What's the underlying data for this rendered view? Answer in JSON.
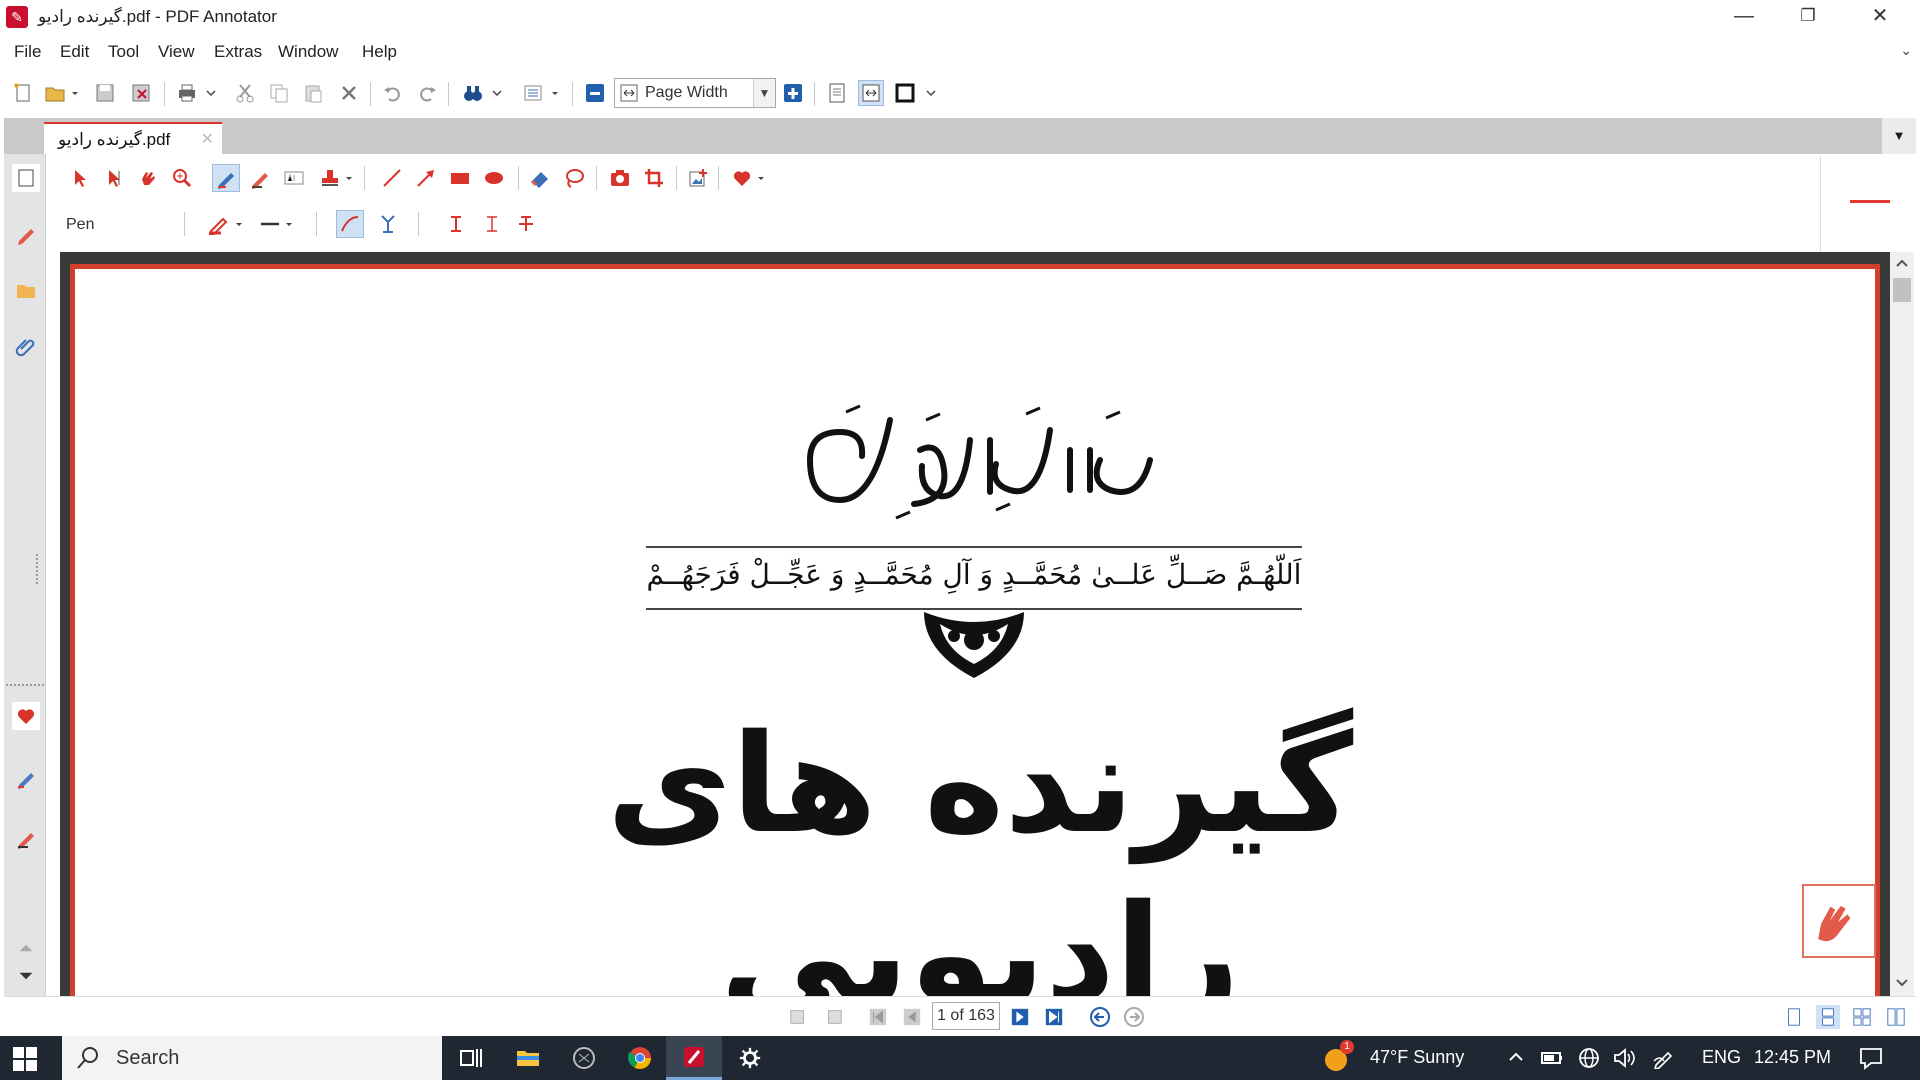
{
  "window": {
    "title": "گیرنده رادیو.pdf - PDF Annotator",
    "minimize": "—",
    "restore": "❐",
    "close": "✕"
  },
  "menu": {
    "items": [
      "File",
      "Edit",
      "Tool",
      "View",
      "Extras",
      "Window",
      "Help"
    ],
    "collapse": "⌄"
  },
  "toolbar": {
    "zoom_mode": "Page Width"
  },
  "tab": {
    "label": "گیرنده رادیو.pdf",
    "close": "✕"
  },
  "annotation_toolbar": {
    "tool_name": "Pen"
  },
  "page": {
    "salawat": "اَللّهُـمَّ صَــلِّ عَلــیٰ مُحَمَّــدٍ وَ آلِ مُحَمَّــدٍ وَ عَجِّــلْ فَرَجَهُــمْ",
    "title": "گیرنده های رادیویی"
  },
  "navigation": {
    "page_indicator": "1 of 163"
  },
  "taskbar": {
    "search_label": "Search",
    "weather_badge": "1",
    "weather": "47°F  Sunny",
    "language": "ENG",
    "time": "12:45 PM"
  },
  "colors": {
    "accent_red": "#d0402d",
    "pen_color": "#e53935",
    "taskbar": "#1f2733"
  }
}
